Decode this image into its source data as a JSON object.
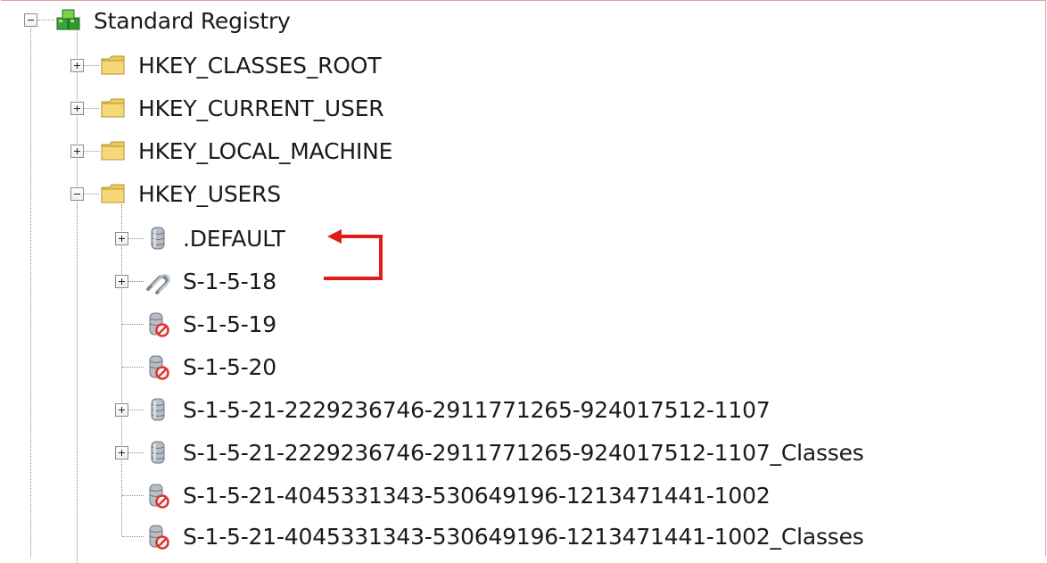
{
  "tree": {
    "root": {
      "label": "Standard Registry",
      "icon": "registry-cubes-icon",
      "expanded": true
    },
    "hives": [
      {
        "label": "HKEY_CLASSES_ROOT",
        "icon": "folder-icon",
        "expanded": false
      },
      {
        "label": "HKEY_CURRENT_USER",
        "icon": "folder-icon",
        "expanded": false
      },
      {
        "label": "HKEY_LOCAL_MACHINE",
        "icon": "folder-icon",
        "expanded": false
      },
      {
        "label": "HKEY_USERS",
        "icon": "folder-icon",
        "expanded": true
      }
    ],
    "users": [
      {
        "label": ".DEFAULT",
        "icon": "database-icon",
        "has_children": true
      },
      {
        "label": "S-1-5-18",
        "icon": "link-icon",
        "has_children": true
      },
      {
        "label": "S-1-5-19",
        "icon": "database-unavailable-icon",
        "has_children": false
      },
      {
        "label": "S-1-5-20",
        "icon": "database-unavailable-icon",
        "has_children": false
      },
      {
        "label": "S-1-5-21-2229236746-2911771265-924017512-1107",
        "icon": "database-icon",
        "has_children": true
      },
      {
        "label": "S-1-5-21-2229236746-2911771265-924017512-1107_Classes",
        "icon": "database-icon",
        "has_children": true
      },
      {
        "label": "S-1-5-21-4045331343-530649196-1213471441-1002",
        "icon": "database-unavailable-icon",
        "has_children": false
      },
      {
        "label": "S-1-5-21-4045331343-530649196-1213471441-1002_Classes",
        "icon": "database-unavailable-icon",
        "has_children": false
      }
    ]
  },
  "annotation": {
    "color": "#e41b1b",
    "meaning": "S-1-5-18 points to .DEFAULT"
  },
  "colors": {
    "folder": "#f0c95c",
    "registry_green": "#3aa33a",
    "database": "#9aa3ad",
    "no_entry": "#e0322e",
    "tree_lines": "#8c8c8c"
  }
}
